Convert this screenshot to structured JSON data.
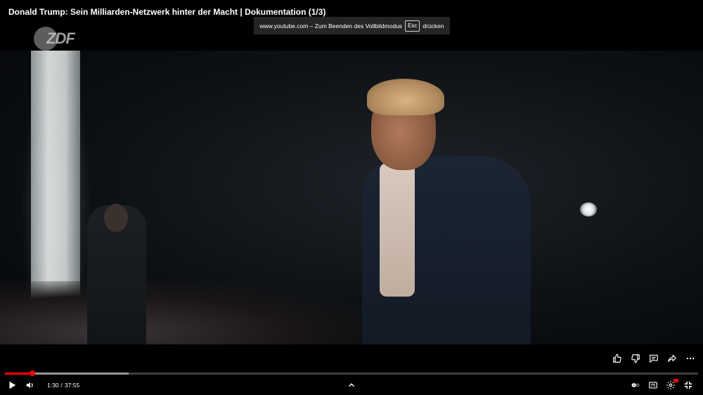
{
  "video": {
    "title": "Donald Trump: Sein Milliarden-Netzwerk hinter der Macht | Dokumentation (1/3)",
    "channel_logo_text": "ZDF"
  },
  "fullscreen_notice": {
    "prefix": "www.youtube.com – Zum Beenden des Vollbildmodus",
    "key": "Esc",
    "suffix": "drücken"
  },
  "actions": {
    "like_icon": "thumbs-up-icon",
    "dislike_icon": "thumbs-down-icon",
    "comments_icon": "comment-icon",
    "share_icon": "share-icon",
    "more_icon": "more-horizontal-icon"
  },
  "progress": {
    "played_fraction": 0.0398,
    "buffered_fraction": 0.178
  },
  "controls": {
    "current_time": "1:30",
    "separator": "/",
    "duration": "37:55",
    "play_icon": "play-icon",
    "volume_icon": "volume-icon",
    "expand_icon": "chevron-up-icon",
    "autoplay_icon": "autoplay-toggle-icon",
    "subtitles_icon": "subtitles-icon",
    "settings_icon": "settings-gear-icon",
    "exit_fullscreen_icon": "exit-fullscreen-icon"
  },
  "colors": {
    "progress_played": "#ff0000",
    "toast_bg": "#282828"
  }
}
